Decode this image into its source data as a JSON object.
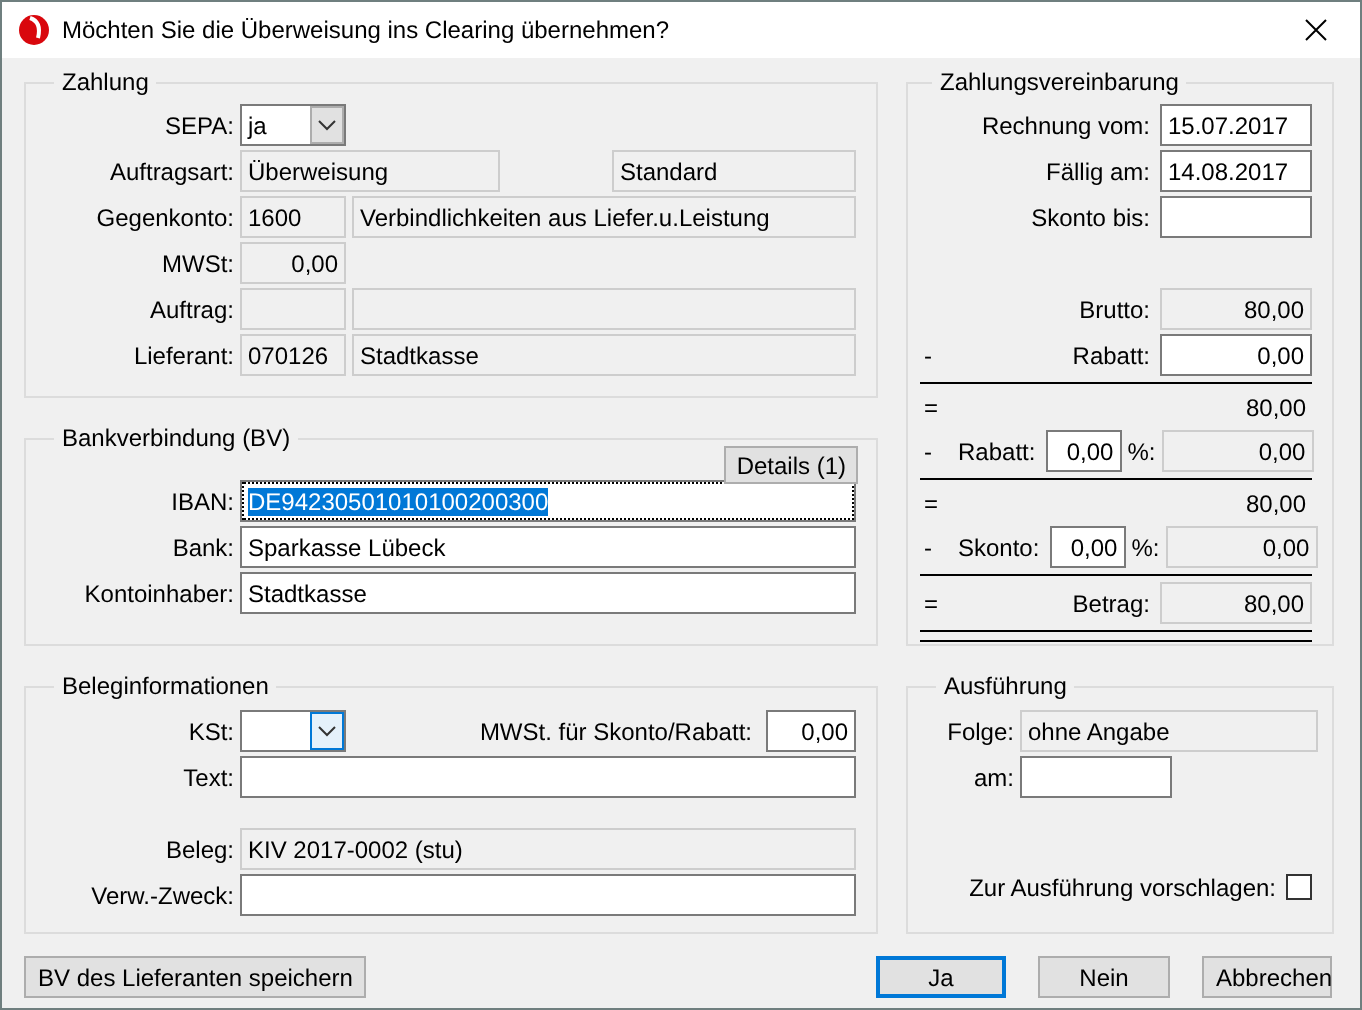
{
  "window": {
    "title": "Möchten Sie die Überweisung ins Clearing übernehmen?"
  },
  "zahlung": {
    "title": "Zahlung",
    "rows": [
      {
        "label": "SEPA:",
        "fields": [
          {
            "kind": "combo",
            "value": "ja",
            "readonly": true,
            "focused": false
          }
        ]
      },
      {
        "label": "Auftragsart:",
        "fields": [
          {
            "kind": "medium",
            "value": "Überweisung",
            "readonly": true
          },
          {
            "kind": "end",
            "value": "Standard",
            "readonly": true
          }
        ]
      },
      {
        "label": "Gegenkonto:",
        "fields": [
          {
            "kind": "short",
            "value": "1600",
            "readonly": true
          },
          {
            "kind": "fill",
            "value": "Verbindlichkeiten aus Liefer.u.Leistung",
            "readonly": true
          }
        ]
      },
      {
        "label": "MWSt:",
        "fields": [
          {
            "kind": "amount",
            "value": "0,00",
            "readonly": true
          }
        ]
      },
      {
        "label": "Auftrag:",
        "fields": [
          {
            "kind": "short",
            "readonly": true
          },
          {
            "kind": "fill",
            "readonly": true
          }
        ]
      },
      {
        "label": "Lieferant:",
        "fields": [
          {
            "kind": "short",
            "value": "070126",
            "readonly": true
          },
          {
            "kind": "fill",
            "value": "Stadtkasse",
            "readonly": true
          }
        ]
      }
    ]
  },
  "bankverbindung": {
    "title": "Bankverbindung (BV)",
    "details_button": "Details (1)",
    "rows": [
      {
        "label": "IBAN:",
        "fields": [
          {
            "kind": "fill",
            "value": "DE94230501010100200300",
            "readonly": false,
            "selected": true
          }
        ]
      },
      {
        "label": "Bank:",
        "fields": [
          {
            "kind": "fill",
            "value": "Sparkasse Lübeck",
            "readonly": false,
            "selected": false
          }
        ]
      },
      {
        "label": "Kontoinhaber:",
        "fields": [
          {
            "kind": "fill",
            "value": "Stadtkasse",
            "readonly": false,
            "selected": false
          }
        ]
      }
    ]
  },
  "beleginformationen": {
    "title": "Beleginformationen",
    "rows": [
      {
        "label": "KSt:",
        "fields": [
          {
            "kind": "combo",
            "readonly": false,
            "focused": true
          },
          {
            "kind": "label",
            "value": "MWSt. für Skonto/Rabatt:"
          },
          {
            "kind": "small",
            "value": "0,00",
            "readonly": false
          }
        ]
      },
      {
        "label": "Text:",
        "fields": [
          {
            "kind": "fill",
            "readonly": false
          }
        ]
      },
      {
        "kind": "spacer"
      },
      {
        "label": "Beleg:",
        "fields": [
          {
            "kind": "fill",
            "value": "KIV 2017-0002 (stu)",
            "readonly": true
          }
        ]
      },
      {
        "label": "Verw.-Zweck:",
        "fields": [
          {
            "kind": "fill",
            "readonly": false
          }
        ]
      }
    ]
  },
  "zahlungsvereinbarung": {
    "title": "Zahlungsvereinbarung",
    "dates": [
      {
        "label": "Rechnung vom:",
        "value": "15.07.2017"
      },
      {
        "label": "Fällig am:",
        "value": "14.08.2017"
      },
      {
        "label": "Skonto bis:"
      }
    ],
    "lines": [
      {
        "kind": "field",
        "label": "Brutto:",
        "value": "80,00",
        "readonly": true
      },
      {
        "kind": "field",
        "sign": "-",
        "label": "Rabatt:",
        "value": "0,00",
        "readonly": false
      },
      {
        "kind": "rule"
      },
      {
        "kind": "result",
        "sign": "=",
        "value": "80,00"
      },
      {
        "kind": "percent",
        "sign": "-",
        "label": "Rabatt:",
        "percent": "0,00",
        "unit": "%:",
        "value": "0,00"
      },
      {
        "kind": "rule"
      },
      {
        "kind": "result",
        "sign": "=",
        "value": "80,00"
      },
      {
        "kind": "percent",
        "sign": "-",
        "label": "Skonto:",
        "percent": "0,00",
        "unit": "%:",
        "value": "0,00"
      },
      {
        "kind": "rule"
      },
      {
        "kind": "field",
        "sign": "=",
        "label": "Betrag:",
        "value": "80,00",
        "readonly": true
      },
      {
        "kind": "double_rule"
      }
    ]
  },
  "ausfuehrung": {
    "title": "Ausführung",
    "folge": {
      "label": "Folge:",
      "value": "ohne Angabe"
    },
    "am": {
      "label": "am:"
    },
    "vorschlagen": {
      "label": "Zur Ausführung vorschlagen:",
      "checked": false
    }
  },
  "buttons_left": [
    {
      "label": "BV des Lieferanten speichern",
      "default": false
    }
  ],
  "buttons_right": [
    {
      "label": "Ja",
      "default": true
    },
    {
      "label": "Nein",
      "default": false
    },
    {
      "label": "Abbrechen",
      "default": false
    }
  ]
}
